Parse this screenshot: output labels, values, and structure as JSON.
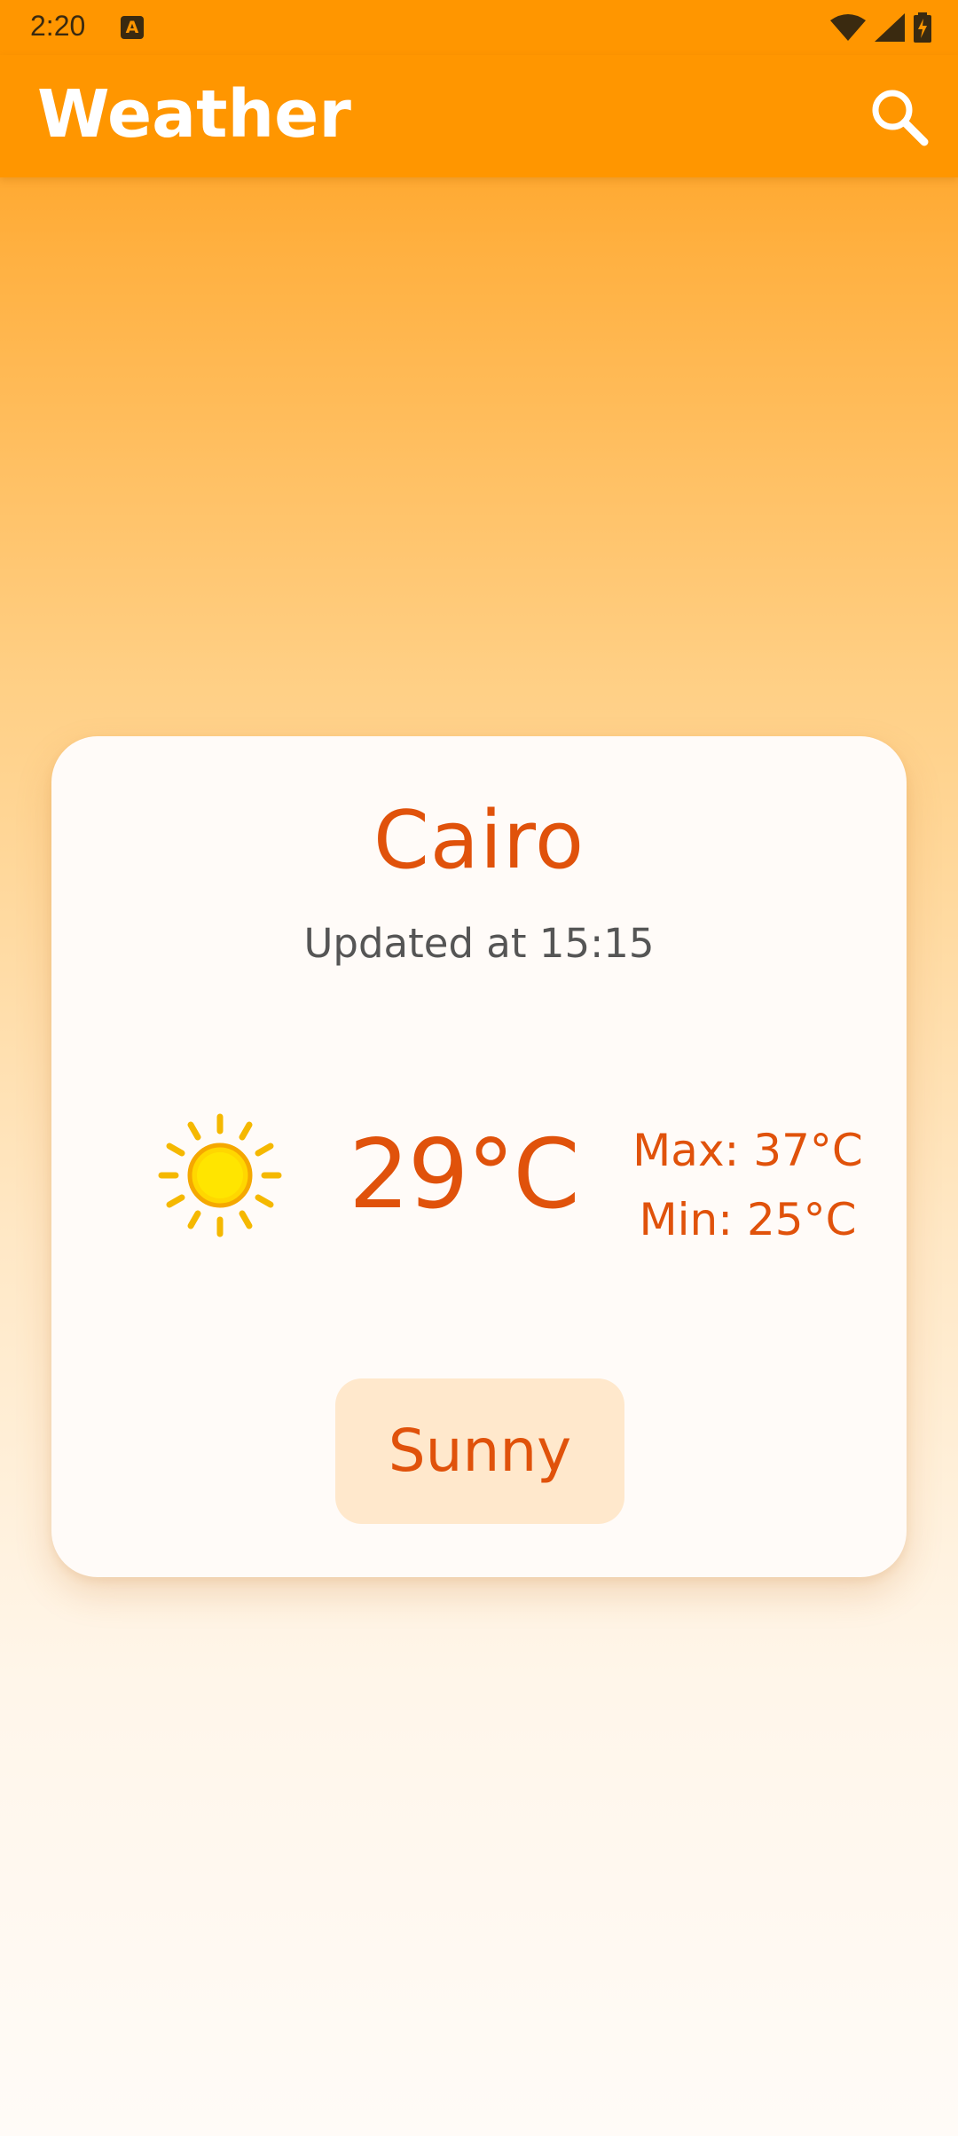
{
  "status_bar": {
    "time": "2:20",
    "notification_icon": "a-letter-icon",
    "icons": [
      "wifi-icon",
      "signal-icon",
      "battery-charging-icon"
    ]
  },
  "app_bar": {
    "title": "Weather",
    "search_icon": "search-icon"
  },
  "weather_card": {
    "city": "Cairo",
    "updated": "Updated at 15:15",
    "condition_icon": "sun-icon",
    "temperature": "29°C",
    "max": "Max: 37°C",
    "min": "Min: 25°C",
    "condition": "Sunny"
  },
  "colors": {
    "app_bar": "#FF9600",
    "accent_text": "#E0520B",
    "card_background": "#FFFBF8",
    "chip_background": "#FFE8CC"
  }
}
